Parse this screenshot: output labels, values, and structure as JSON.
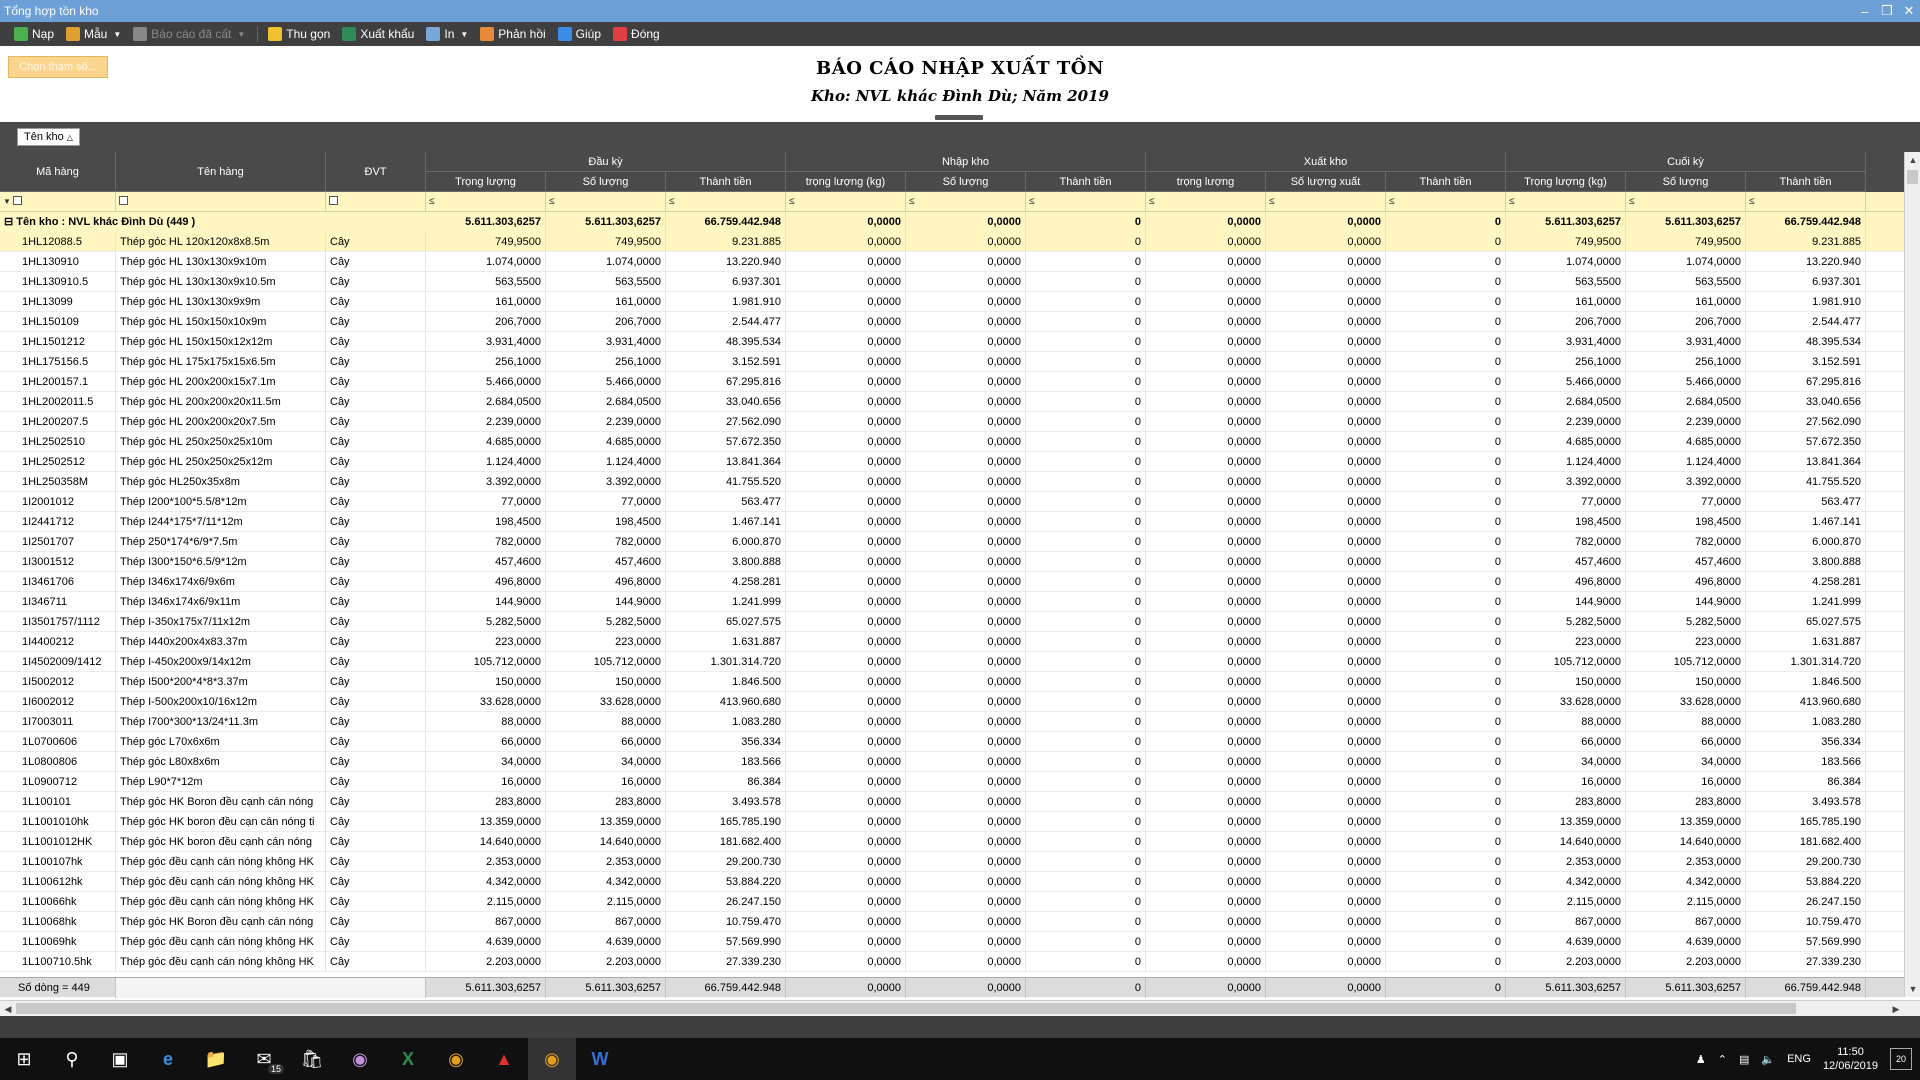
{
  "window": {
    "title": "Tổng hợp tồn kho"
  },
  "toolbar": {
    "items": [
      {
        "label": "Nạp",
        "icon": "reload-icon",
        "color": "#4caf50"
      },
      {
        "label": "Mẫu",
        "icon": "template-icon",
        "color": "#e0a030",
        "caret": true
      },
      {
        "label": "Báo cáo đã cất",
        "icon": "saved-report-icon",
        "color": "#888888",
        "caret": true,
        "disabled": true
      },
      {
        "label": "Thu gọn",
        "icon": "collapse-icon",
        "color": "#f0c030"
      },
      {
        "label": "Xuất khẩu",
        "icon": "excel-export-icon",
        "color": "#2e8b57"
      },
      {
        "label": "In",
        "icon": "print-icon",
        "color": "#7aa7d8",
        "caret": true
      },
      {
        "label": "Phản hồi",
        "icon": "feedback-mail-icon",
        "color": "#e88a3a"
      },
      {
        "label": "Giúp",
        "icon": "help-icon",
        "color": "#3a8ee6"
      },
      {
        "label": "Đóng",
        "icon": "close-power-icon",
        "color": "#e04040"
      }
    ]
  },
  "params_button": "Chọn tham số...",
  "report": {
    "title": "BÁO CÁO NHẬP XUẤT TỒN",
    "subtitle": "Kho: NVL khác Đình Dù; Năm 2019"
  },
  "group_chip": "Tên kho",
  "columns": {
    "ma_hang": "Mã hàng",
    "ten_hang": "Tên hàng",
    "dvt": "ĐVT",
    "groups": [
      "Đầu kỳ",
      "Nhập kho",
      "Xuất kho",
      "Cuối kỳ"
    ],
    "sub": [
      "Trọng lượng",
      "Số lượng",
      "Thành tiền",
      "trọng lượng (kg)",
      "Số lượng",
      "Thành tiền",
      "trọng lượng",
      "Số lượng xuất",
      "Thành tiền",
      "Trọng lượng (kg)",
      "Số lượng",
      "Thành tiền"
    ]
  },
  "group_row": {
    "label": "Tên kho : NVL khác Đình Dù (449 )",
    "values": [
      "5.611.303,6257",
      "5.611.303,6257",
      "66.759.442.948",
      "0,0000",
      "0,0000",
      "0",
      "0,0000",
      "0,0000",
      "0",
      "5.611.303,6257",
      "5.611.303,6257",
      "66.759.442.948"
    ]
  },
  "rows": [
    [
      "1HL12088.5",
      "Thép góc HL 120x120x8x8.5m",
      "Cây",
      "749,9500",
      "749,9500",
      "9.231.885"
    ],
    [
      "1HL130910",
      "Thép góc HL 130x130x9x10m",
      "Cây",
      "1.074,0000",
      "1.074,0000",
      "13.220.940"
    ],
    [
      "1HL130910.5",
      "Thép góc HL 130x130x9x10.5m",
      "Cây",
      "563,5500",
      "563,5500",
      "6.937.301"
    ],
    [
      "1HL13099",
      "Thép góc HL 130x130x9x9m",
      "Cây",
      "161,0000",
      "161,0000",
      "1.981.910"
    ],
    [
      "1HL150109",
      "Thép góc HL 150x150x10x9m",
      "Cây",
      "206,7000",
      "206,7000",
      "2.544.477"
    ],
    [
      "1HL1501212",
      "Thép góc HL 150x150x12x12m",
      "Cây",
      "3.931,4000",
      "3.931,4000",
      "48.395.534"
    ],
    [
      "1HL175156.5",
      "Thép góc HL 175x175x15x6.5m",
      "Cây",
      "256,1000",
      "256,1000",
      "3.152.591"
    ],
    [
      "1HL200157.1",
      "Thép góc HL 200x200x15x7.1m",
      "Cây",
      "5.466,0000",
      "5.466,0000",
      "67.295.816"
    ],
    [
      "1HL2002011.5",
      "Thép góc HL 200x200x20x11.5m",
      "Cây",
      "2.684,0500",
      "2.684,0500",
      "33.040.656"
    ],
    [
      "1HL200207.5",
      "Thép góc HL 200x200x20x7.5m",
      "Cây",
      "2.239,0000",
      "2.239,0000",
      "27.562.090"
    ],
    [
      "1HL2502510",
      "Thép góc HL 250x250x25x10m",
      "Cây",
      "4.685,0000",
      "4.685,0000",
      "57.672.350"
    ],
    [
      "1HL2502512",
      "Thép góc HL 250x250x25x12m",
      "Cây",
      "1.124,4000",
      "1.124,4000",
      "13.841.364"
    ],
    [
      "1HL250358M",
      "Thép góc HL250x35x8m",
      "Cây",
      "3.392,0000",
      "3.392,0000",
      "41.755.520"
    ],
    [
      "1I2001012",
      "Thép I200*100*5.5/8*12m",
      "Cây",
      "77,0000",
      "77,0000",
      "563.477"
    ],
    [
      "1I2441712",
      "Thép I244*175*7/11*12m",
      "Cây",
      "198,4500",
      "198,4500",
      "1.467.141"
    ],
    [
      "1I2501707",
      "Thép 250*174*6/9*7.5m",
      "Cây",
      "782,0000",
      "782,0000",
      "6.000.870"
    ],
    [
      "1I3001512",
      "Thép I300*150*6.5/9*12m",
      "Cây",
      "457,4600",
      "457,4600",
      "3.800.888"
    ],
    [
      "1I3461706",
      "Thép I346x174x6/9x6m",
      "Cây",
      "496,8000",
      "496,8000",
      "4.258.281"
    ],
    [
      "1I346711",
      "Thép I346x174x6/9x11m",
      "Cây",
      "144,9000",
      "144,9000",
      "1.241.999"
    ],
    [
      "1I3501757/1112",
      "Thép I-350x175x7/11x12m",
      "Cây",
      "5.282,5000",
      "5.282,5000",
      "65.027.575"
    ],
    [
      "1I4400212",
      "Thép I440x200x4x83.37m",
      "Cây",
      "223,0000",
      "223,0000",
      "1.631.887"
    ],
    [
      "1I4502009/1412",
      "Thép I-450x200x9/14x12m",
      "Cây",
      "105.712,0000",
      "105.712,0000",
      "1.301.314.720"
    ],
    [
      "1I5002012",
      "Thép I500*200*4*8*3.37m",
      "Cây",
      "150,0000",
      "150,0000",
      "1.846.500"
    ],
    [
      "1I6002012",
      "Thép I-500x200x10/16x12m",
      "Cây",
      "33.628,0000",
      "33.628,0000",
      "413.960.680"
    ],
    [
      "1I7003011",
      "Thép I700*300*13/24*11.3m",
      "Cây",
      "88,0000",
      "88,0000",
      "1.083.280"
    ],
    [
      "1L0700606",
      "Thép góc L70x6x6m",
      "Cây",
      "66,0000",
      "66,0000",
      "356.334"
    ],
    [
      "1L0800806",
      "Thép góc L80x8x6m",
      "Cây",
      "34,0000",
      "34,0000",
      "183.566"
    ],
    [
      "1L0900712",
      "Thép L90*7*12m",
      "Cây",
      "16,0000",
      "16,0000",
      "86.384"
    ],
    [
      "1L100101",
      "Thép góc HK Boron đều cạnh cán nóng",
      "Cây",
      "283,8000",
      "283,8000",
      "3.493.578"
    ],
    [
      "1L1001010hk",
      "Thép góc HK boron đều cạn cán nóng ti",
      "Cây",
      "13.359,0000",
      "13.359,0000",
      "165.785.190"
    ],
    [
      "1L1001012HK",
      "Thép góc HK boron đều cạnh cán nóng",
      "Cây",
      "14.640,0000",
      "14.640,0000",
      "181.682.400"
    ],
    [
      "1L100107hk",
      "Thép góc đều cạnh cán nóng không HK",
      "Cây",
      "2.353,0000",
      "2.353,0000",
      "29.200.730"
    ],
    [
      "1L100612hk",
      "Thép góc đều cạnh cán nóng không HK",
      "Cây",
      "4.342,0000",
      "4.342,0000",
      "53.884.220"
    ],
    [
      "1L10066hk",
      "Thép góc đều cạnh cán nóng không HK",
      "Cây",
      "2.115,0000",
      "2.115,0000",
      "26.247.150"
    ],
    [
      "1L10068hk",
      "Thép góc HK Boron đều cạnh cán nóng",
      "Cây",
      "867,0000",
      "867,0000",
      "10.759.470"
    ],
    [
      "1L10069hk",
      "Thép góc đều cạnh cán nóng không HK",
      "Cây",
      "4.639,0000",
      "4.639,0000",
      "57.569.990"
    ],
    [
      "1L100710.5hk",
      "Thép góc đều cạnh cán nóng không HK",
      "Cây",
      "2.203,0000",
      "2.203,0000",
      "27.339.230"
    ]
  ],
  "zero_values": {
    "weight": "0,0000",
    "qty": "0,0000",
    "amount": "0"
  },
  "footer": {
    "count": "Số dòng = 449",
    "values": [
      "5.611.303,6257",
      "5.611.303,6257",
      "66.759.442.948",
      "0,0000",
      "0,0000",
      "0",
      "0,0000",
      "0,0000",
      "0",
      "5.611.303,6257",
      "5.611.303,6257",
      "66.759.442.948"
    ]
  },
  "taskbar": {
    "language": "ENG",
    "time": "11:50",
    "date": "12/06/2019",
    "mail_badge": "15",
    "notif_count": "20"
  }
}
